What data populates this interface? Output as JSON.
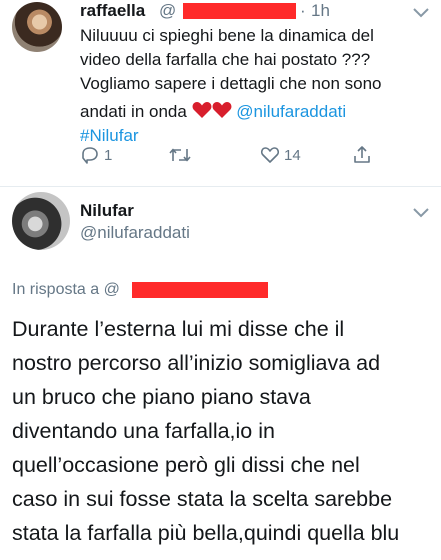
{
  "tweet1": {
    "name": "raffaella",
    "handle_prefix": "@",
    "dot": "·",
    "time": "1h",
    "lines": [
      "Niluuuu ci spieghi bene la dinamica del",
      "video della farfalla che hai postato ???",
      "Vogliamo sapere i dettagli che non sono"
    ],
    "line4_text": "andati in onda",
    "line4_emoji": "red-heart-emoji x2",
    "mention": "@nilufaraddati",
    "hashtag": "#Nilufar",
    "reply_count": "1",
    "retweet_count": "",
    "like_count": "14"
  },
  "tweet2": {
    "name": "Nilufar",
    "handle": "@nilufaraddati",
    "reply_label": "In risposta a @",
    "lines": [
      "Durante l’esterna lui mi disse che il",
      "nostro percorso all’inizio somigliava ad",
      "un bruco che piano piano stava",
      "diventando una farfalla,io in",
      "quell’occasione però gli dissi che nel",
      "caso in sui fosse stata la scelta sarebbe",
      "stata la farfalla più bella,quindi quella blu"
    ]
  },
  "colors": {
    "link": "#1b95e0",
    "muted": "#657786",
    "redaction": "#ff2a2a",
    "heart": "#e0245e"
  },
  "icons": [
    "chevron-down-icon",
    "reply-icon",
    "retweet-icon",
    "like-icon",
    "share-icon",
    "red-heart-emoji"
  ]
}
